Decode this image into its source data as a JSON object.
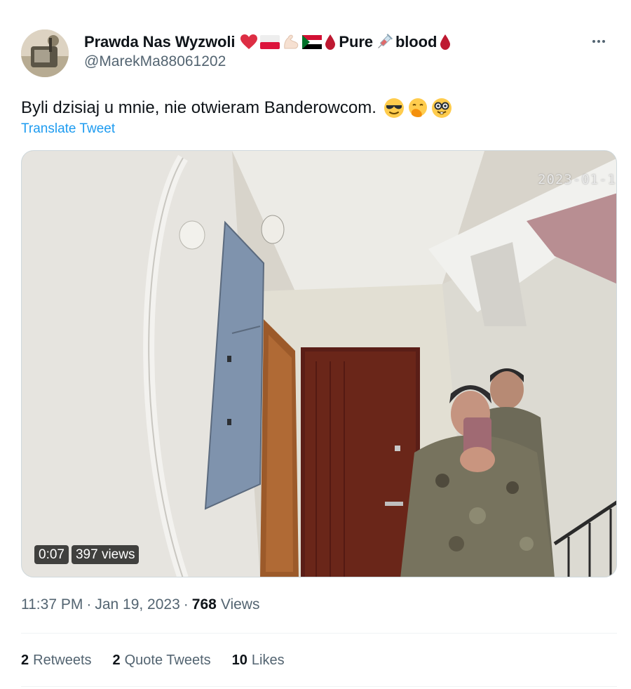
{
  "header": {
    "display_name": "Prawda Nas Wyzwoli",
    "pure_word": "Pure",
    "blood_word": "blood",
    "handle": "@MarekMa88061202",
    "name_emojis": [
      "red-heart",
      "poland-flag",
      "flexed-biceps",
      "sudan-flag",
      "drop-of-blood",
      "syringe",
      "drop-of-blood"
    ]
  },
  "tweet": {
    "text": "Byli dzisiaj u mnie, nie otwieram Banderowcom.",
    "text_emojis": [
      "smiling-face-with-sunglasses",
      "face-with-hand-over-mouth",
      "nerd-face"
    ],
    "translate_label": "Translate Tweet"
  },
  "media": {
    "video_timestamp": "2023-01-1",
    "duration": "0:07",
    "views_badge": "397 views"
  },
  "meta": {
    "time": "11:37 PM",
    "date": "Jan 19, 2023",
    "views_count": "768",
    "views_label": "Views"
  },
  "stats": {
    "retweets_count": "2",
    "retweets_label": "Retweets",
    "quotes_count": "2",
    "quotes_label": "Quote Tweets",
    "likes_count": "10",
    "likes_label": "Likes"
  },
  "colors": {
    "link": "#1d9bf0",
    "secondary_text": "#536471",
    "primary_text": "#0f1419",
    "divider": "#eff3f4"
  }
}
